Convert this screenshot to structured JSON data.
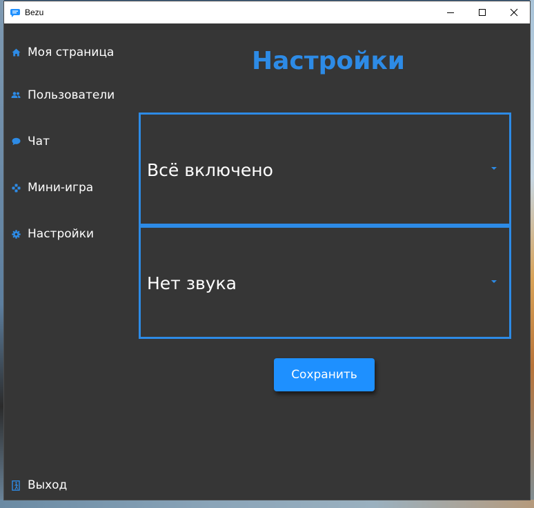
{
  "window": {
    "title": "Bezu"
  },
  "colors": {
    "accent": "#2d8be6",
    "button": "#1e90ff",
    "background": "#363636",
    "text": "#ffffff"
  },
  "sidebar": {
    "items": [
      {
        "label": "Моя страница",
        "icon": "home-icon"
      },
      {
        "label": "Пользователи",
        "icon": "users-icon"
      },
      {
        "label": "Чат",
        "icon": "chat-bubble-icon"
      },
      {
        "label": "Мини-игра",
        "icon": "gamepad-icon"
      },
      {
        "label": "Настройки",
        "icon": "gear-icon"
      }
    ],
    "logout": {
      "label": "Выход",
      "icon": "exit-door-icon"
    }
  },
  "main": {
    "title": "Настройки",
    "notifications_select": {
      "value": "Всё включено"
    },
    "sound_select": {
      "value": "Нет звука"
    },
    "save_label": "Сохранить"
  }
}
